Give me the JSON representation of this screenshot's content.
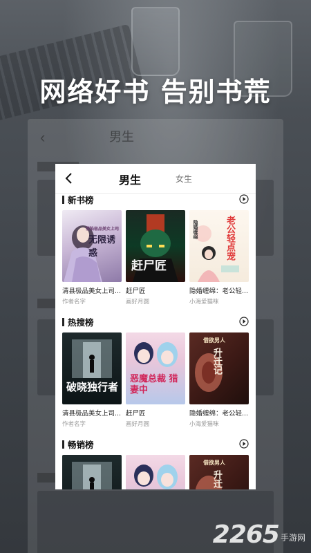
{
  "headline": "网络好书 告别书荒",
  "tabs": {
    "male": "男生",
    "female": "女生"
  },
  "sections": [
    {
      "title": "新书榜",
      "books": [
        {
          "title": "清县极品美女上司...",
          "author": "作者名字",
          "cover_text": "无限诱惑",
          "cover_sub": "情陷极品美女上司"
        },
        {
          "title": "赶尸匠",
          "author": "画好月圆",
          "cover_text": "赶尸匠",
          "cover_sub": "赶尸匠"
        },
        {
          "title": "隐婚缠绵：老公轻...",
          "author": "小海爱猫咪",
          "cover_text": "老公轻点宠",
          "cover_sub": "隐婚缠绵"
        }
      ]
    },
    {
      "title": "热搜榜",
      "books": [
        {
          "title": "清县极品美女上司...",
          "author": "作者名字",
          "cover_text": "破晓独行者",
          "cover_sub": ""
        },
        {
          "title": "赶尸匠",
          "author": "画好月圆",
          "cover_text": "恶魔总裁 猎妻中",
          "cover_sub": ""
        },
        {
          "title": "隐婚缠绵：老公轻...",
          "author": "小海爱猫咪",
          "cover_text": "升迁记",
          "cover_sub": "借欲男人"
        }
      ]
    },
    {
      "title": "畅销榜",
      "books": [
        {
          "title": "",
          "author": "",
          "cover_text": "",
          "cover_sub": ""
        },
        {
          "title": "",
          "author": "",
          "cover_text": "",
          "cover_sub": ""
        },
        {
          "title": "",
          "author": "",
          "cover_text": "升迁",
          "cover_sub": "借欲男人"
        }
      ]
    }
  ],
  "watermark": {
    "brand": "2265",
    "suffix": "手游网"
  }
}
